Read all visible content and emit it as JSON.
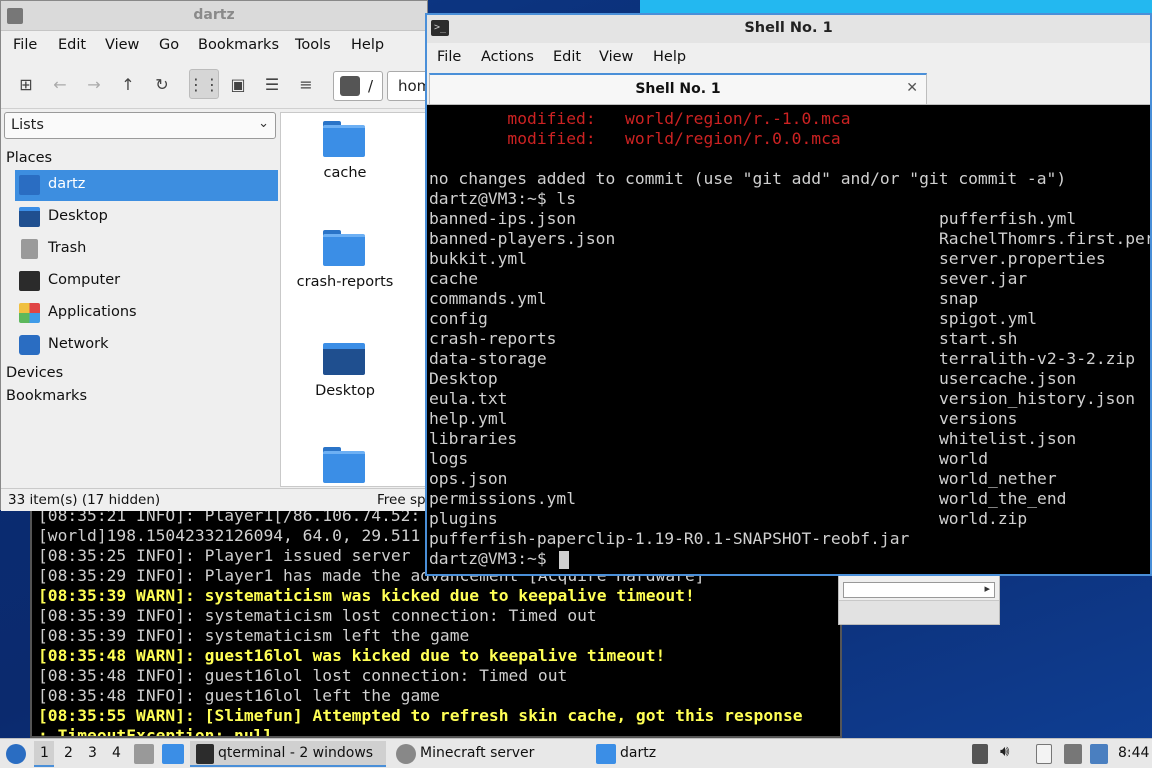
{
  "desktop": {
    "file_manager": {
      "title": "dartz",
      "menu": [
        "File",
        "Edit",
        "View",
        "Go",
        "Bookmarks",
        "Tools",
        "Help"
      ],
      "path_root": "/",
      "path_home": "hom",
      "side_combo": "Lists",
      "places_heading": "Places",
      "places": [
        "dartz",
        "Desktop",
        "Trash",
        "Computer",
        "Applications",
        "Network"
      ],
      "devices_heading": "Devices",
      "bookmarks_heading": "Bookmarks",
      "items": [
        "cache",
        "crash-reports",
        "Desktop"
      ],
      "status_left": "33 item(s) (17 hidden)",
      "status_right": "Free sp"
    },
    "terminal": {
      "title": "Shell No. 1",
      "menu": [
        "File",
        "Actions",
        "Edit",
        "View",
        "Help"
      ],
      "tab_label": "Shell No. 1",
      "modified_lines": [
        "        modified:   world/region/r.-1.0.mca",
        "        modified:   world/region/r.0.0.mca"
      ],
      "commit_line": "no changes added to commit (use \"git add\" and/or \"git commit -a\")",
      "prompt_ls": "dartz@VM3:~$ ls",
      "ls_left": [
        "banned-ips.json",
        "banned-players.json",
        "bukkit.yml",
        "cache",
        "commands.yml",
        "config",
        "crash-reports",
        "data-storage",
        "Desktop",
        "eula.txt",
        "help.yml",
        "libraries",
        "logs",
        "ops.json",
        "permissions.yml",
        "plugins"
      ],
      "ls_right": [
        "pufferfish.yml",
        "RachelThomrs.first.per",
        "server.properties",
        "sever.jar",
        "snap",
        "spigot.yml",
        "start.sh",
        "terralith-v2-3-2.zip",
        "usercache.json",
        "version_history.json",
        "versions",
        "whitelist.json",
        "world",
        "world_nether",
        "world_the_end",
        "world.zip"
      ],
      "jar_line": "pufferfish-paperclip-1.19-R0.1-SNAPSHOT-reobf.jar",
      "prompt": "dartz@VM3:~$ "
    },
    "server_log": {
      "lines": [
        {
          "text": "[08:35:21 INFO]: Player1[/86.106.74.52:",
          "warn": false
        },
        {
          "text": "[world]198.15042332126094, 64.0, 29.511",
          "warn": false
        },
        {
          "text": "[08:35:25 INFO]: Player1 issued server",
          "warn": false
        },
        {
          "text": "[08:35:29 INFO]: Player1 has made the advancement [Acquire Hardware]",
          "warn": false
        },
        {
          "text": "[08:35:39 WARN]: systematicism was kicked due to keepalive timeout!",
          "warn": true
        },
        {
          "text": "[08:35:39 INFO]: systematicism lost connection: Timed out",
          "warn": false
        },
        {
          "text": "[08:35:39 INFO]: systematicism left the game",
          "warn": false
        },
        {
          "text": "[08:35:48 WARN]: guest16lol was kicked due to keepalive timeout!",
          "warn": true
        },
        {
          "text": "[08:35:48 INFO]: guest16lol lost connection: Timed out",
          "warn": false
        },
        {
          "text": "[08:35:48 INFO]: guest16lol left the game",
          "warn": false
        },
        {
          "text": "[08:35:55 WARN]: [Slimefun] Attempted to refresh skin cache, got this response",
          "warn": true
        },
        {
          "text": ": TimeoutException: null",
          "warn": true
        }
      ]
    }
  },
  "taskbar": {
    "workspaces": [
      "1",
      "2",
      "3",
      "4"
    ],
    "tasks": [
      "qterminal - 2 windows",
      "Minecraft server",
      "dartz"
    ],
    "clock": "8:44"
  },
  "colors": {
    "accent": "#3d8ee0",
    "terminal_bg": "#000000",
    "warn": "#ffff55",
    "modified": "#cc2222"
  }
}
